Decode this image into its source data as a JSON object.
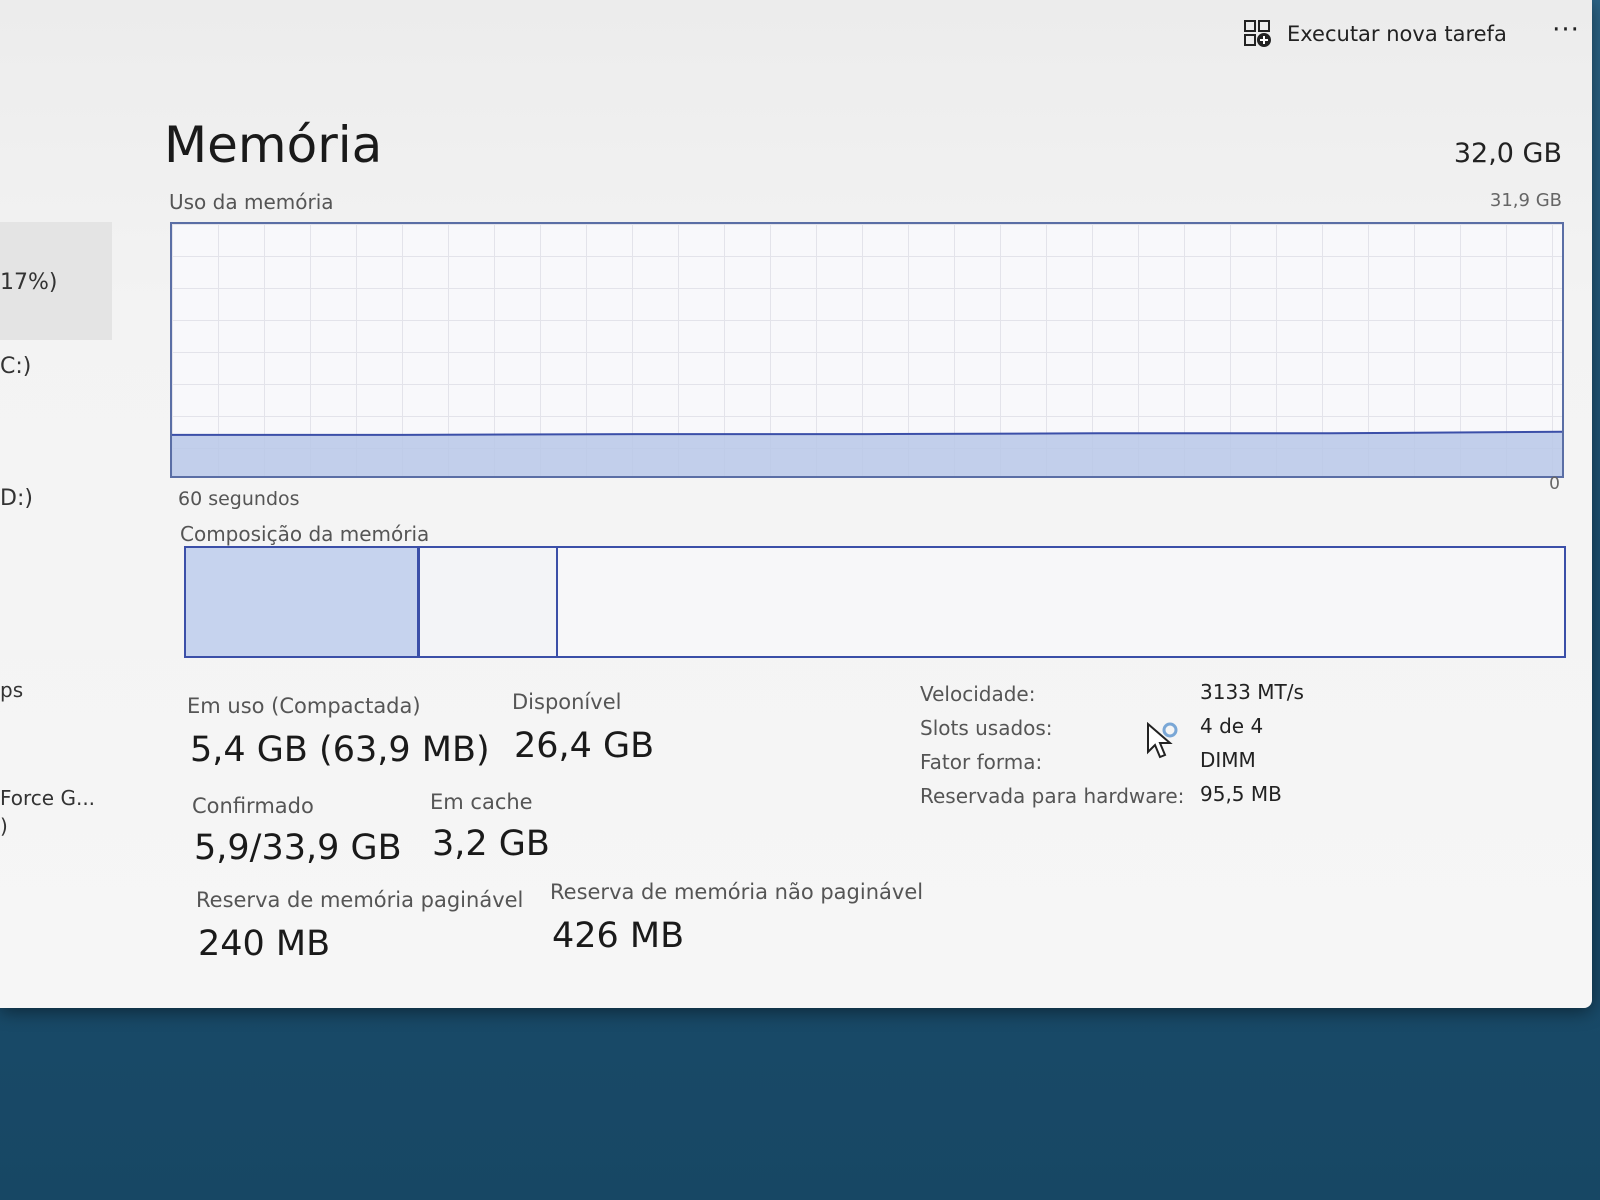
{
  "toolbar": {
    "run_new_task": "Executar nova tarefa",
    "more": "···"
  },
  "sidebar": {
    "items": [
      {
        "label": "17%)"
      },
      {
        "label": "C:)"
      },
      {
        "label": "D:)"
      },
      {
        "label": "ps"
      },
      {
        "label": "Force G..."
      },
      {
        "label": ")"
      }
    ]
  },
  "memory": {
    "title": "Memória",
    "total": "32,0 GB",
    "usage_label": "Uso da memória",
    "max_label": "31,9 GB",
    "seconds_label": "60 segundos",
    "zero_label": "0",
    "composition_label": "Composição da memória"
  },
  "stats": {
    "in_use_label": "Em uso (Compactada)",
    "in_use_value": "5,4 GB (63,9 MB)",
    "available_label": "Disponível",
    "available_value": "26,4 GB",
    "committed_label": "Confirmado",
    "committed_value": "5,9/33,9 GB",
    "cached_label": "Em cache",
    "cached_value": "3,2 GB",
    "paged_pool_label": "Reserva de memória paginável",
    "paged_pool_value": "240 MB",
    "nonpaged_pool_label": "Reserva de memória não paginável",
    "nonpaged_pool_value": "426 MB"
  },
  "details": {
    "speed_label": "Velocidade:",
    "speed_value": "3133 MT/s",
    "slots_label": "Slots usados:",
    "slots_value": "4 de 4",
    "form_label": "Fator forma:",
    "form_value": "DIMM",
    "reserved_label": "Reservada para hardware:",
    "reserved_value": "95,5 MB"
  },
  "chart_data": {
    "type": "area",
    "title": "Uso da memória",
    "xlabel": "60 segundos",
    "ylim": [
      0,
      31.9
    ],
    "x": [
      60,
      50,
      40,
      30,
      20,
      10,
      0
    ],
    "values": [
      5.2,
      5.2,
      5.3,
      5.3,
      5.4,
      5.4,
      5.6
    ]
  },
  "composition": {
    "in_use_fraction": 0.17,
    "cached_fraction": 0.1
  },
  "colors": {
    "accent": "#3b4fa8",
    "fill": "#b9c8e8"
  }
}
